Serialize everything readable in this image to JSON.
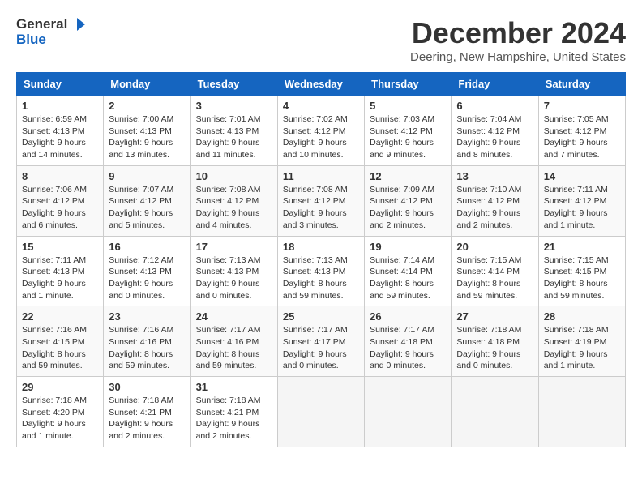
{
  "header": {
    "logo_general": "General",
    "logo_blue": "Blue",
    "month_title": "December 2024",
    "location": "Deering, New Hampshire, United States"
  },
  "weekdays": [
    "Sunday",
    "Monday",
    "Tuesday",
    "Wednesday",
    "Thursday",
    "Friday",
    "Saturday"
  ],
  "weeks": [
    [
      {
        "day": "1",
        "info": "Sunrise: 6:59 AM\nSunset: 4:13 PM\nDaylight: 9 hours\nand 14 minutes."
      },
      {
        "day": "2",
        "info": "Sunrise: 7:00 AM\nSunset: 4:13 PM\nDaylight: 9 hours\nand 13 minutes."
      },
      {
        "day": "3",
        "info": "Sunrise: 7:01 AM\nSunset: 4:13 PM\nDaylight: 9 hours\nand 11 minutes."
      },
      {
        "day": "4",
        "info": "Sunrise: 7:02 AM\nSunset: 4:12 PM\nDaylight: 9 hours\nand 10 minutes."
      },
      {
        "day": "5",
        "info": "Sunrise: 7:03 AM\nSunset: 4:12 PM\nDaylight: 9 hours\nand 9 minutes."
      },
      {
        "day": "6",
        "info": "Sunrise: 7:04 AM\nSunset: 4:12 PM\nDaylight: 9 hours\nand 8 minutes."
      },
      {
        "day": "7",
        "info": "Sunrise: 7:05 AM\nSunset: 4:12 PM\nDaylight: 9 hours\nand 7 minutes."
      }
    ],
    [
      {
        "day": "8",
        "info": "Sunrise: 7:06 AM\nSunset: 4:12 PM\nDaylight: 9 hours\nand 6 minutes."
      },
      {
        "day": "9",
        "info": "Sunrise: 7:07 AM\nSunset: 4:12 PM\nDaylight: 9 hours\nand 5 minutes."
      },
      {
        "day": "10",
        "info": "Sunrise: 7:08 AM\nSunset: 4:12 PM\nDaylight: 9 hours\nand 4 minutes."
      },
      {
        "day": "11",
        "info": "Sunrise: 7:08 AM\nSunset: 4:12 PM\nDaylight: 9 hours\nand 3 minutes."
      },
      {
        "day": "12",
        "info": "Sunrise: 7:09 AM\nSunset: 4:12 PM\nDaylight: 9 hours\nand 2 minutes."
      },
      {
        "day": "13",
        "info": "Sunrise: 7:10 AM\nSunset: 4:12 PM\nDaylight: 9 hours\nand 2 minutes."
      },
      {
        "day": "14",
        "info": "Sunrise: 7:11 AM\nSunset: 4:12 PM\nDaylight: 9 hours\nand 1 minute."
      }
    ],
    [
      {
        "day": "15",
        "info": "Sunrise: 7:11 AM\nSunset: 4:13 PM\nDaylight: 9 hours\nand 1 minute."
      },
      {
        "day": "16",
        "info": "Sunrise: 7:12 AM\nSunset: 4:13 PM\nDaylight: 9 hours\nand 0 minutes."
      },
      {
        "day": "17",
        "info": "Sunrise: 7:13 AM\nSunset: 4:13 PM\nDaylight: 9 hours\nand 0 minutes."
      },
      {
        "day": "18",
        "info": "Sunrise: 7:13 AM\nSunset: 4:13 PM\nDaylight: 8 hours\nand 59 minutes."
      },
      {
        "day": "19",
        "info": "Sunrise: 7:14 AM\nSunset: 4:14 PM\nDaylight: 8 hours\nand 59 minutes."
      },
      {
        "day": "20",
        "info": "Sunrise: 7:15 AM\nSunset: 4:14 PM\nDaylight: 8 hours\nand 59 minutes."
      },
      {
        "day": "21",
        "info": "Sunrise: 7:15 AM\nSunset: 4:15 PM\nDaylight: 8 hours\nand 59 minutes."
      }
    ],
    [
      {
        "day": "22",
        "info": "Sunrise: 7:16 AM\nSunset: 4:15 PM\nDaylight: 8 hours\nand 59 minutes."
      },
      {
        "day": "23",
        "info": "Sunrise: 7:16 AM\nSunset: 4:16 PM\nDaylight: 8 hours\nand 59 minutes."
      },
      {
        "day": "24",
        "info": "Sunrise: 7:17 AM\nSunset: 4:16 PM\nDaylight: 8 hours\nand 59 minutes."
      },
      {
        "day": "25",
        "info": "Sunrise: 7:17 AM\nSunset: 4:17 PM\nDaylight: 9 hours\nand 0 minutes."
      },
      {
        "day": "26",
        "info": "Sunrise: 7:17 AM\nSunset: 4:18 PM\nDaylight: 9 hours\nand 0 minutes."
      },
      {
        "day": "27",
        "info": "Sunrise: 7:18 AM\nSunset: 4:18 PM\nDaylight: 9 hours\nand 0 minutes."
      },
      {
        "day": "28",
        "info": "Sunrise: 7:18 AM\nSunset: 4:19 PM\nDaylight: 9 hours\nand 1 minute."
      }
    ],
    [
      {
        "day": "29",
        "info": "Sunrise: 7:18 AM\nSunset: 4:20 PM\nDaylight: 9 hours\nand 1 minute."
      },
      {
        "day": "30",
        "info": "Sunrise: 7:18 AM\nSunset: 4:21 PM\nDaylight: 9 hours\nand 2 minutes."
      },
      {
        "day": "31",
        "info": "Sunrise: 7:18 AM\nSunset: 4:21 PM\nDaylight: 9 hours\nand 2 minutes."
      },
      null,
      null,
      null,
      null
    ]
  ]
}
